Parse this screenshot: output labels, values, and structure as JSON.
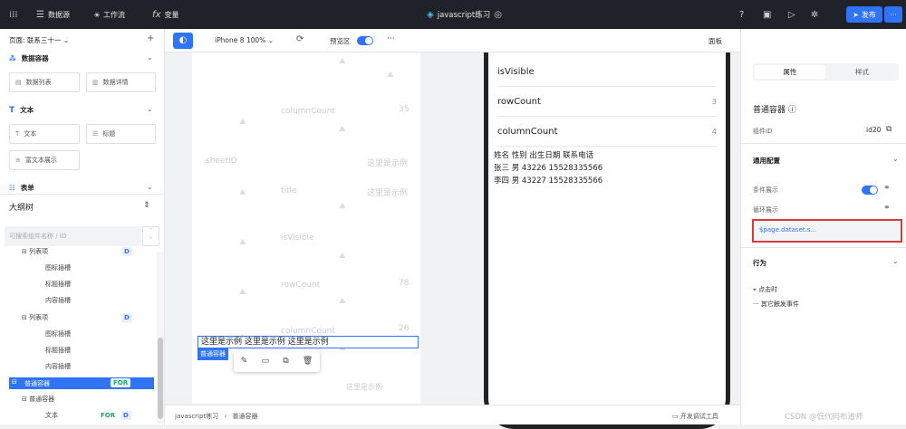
{
  "topbar": {
    "grid_icon": "grid-icon",
    "datasource": "数据源",
    "workflow": "工作流",
    "variables": "变量",
    "app_title": "javascript练习",
    "publish": "发布",
    "more": "···"
  },
  "left": {
    "page_selector": "页面: 联系三十一",
    "add": "+",
    "sections": {
      "data_container": "数据容器",
      "text": "文本",
      "form": "表单"
    },
    "components": {
      "data_list": "数据列表",
      "data_detail": "数据详情",
      "text": "文本",
      "title": "标题",
      "rich_text": "富文本展示"
    },
    "outline_title": "大纲树",
    "search_placeholder": "可搜索组件名称 / ID",
    "tree": {
      "r0": "列表项",
      "r0_badge": "D",
      "r1": "图标插槽",
      "r2": "标题插槽",
      "r3": "内容插槽",
      "r4": "列表项",
      "r4_badge": "D",
      "r5": "图标插槽",
      "r6": "标题插槽",
      "r7": "内容插槽",
      "r8": "普通容器",
      "r8_badge": "FOR",
      "r9": "普通容器",
      "r10": "文本",
      "r10_badge1": "FOR",
      "r10_badge2": "D"
    }
  },
  "canvas": {
    "device": "iPhone 8 100%",
    "preview": "预览区",
    "more": "···",
    "panel_btn": "面板",
    "ghost": {
      "columnCount": "columnCount",
      "columnCount_num": "35",
      "sheetID": "sheetID",
      "example1": "这里是示例",
      "title": "title",
      "example2": "这里是示例",
      "isVisible": "isVisible",
      "rowCount": "rowCount",
      "rowCount_num": "78",
      "columnCount2": "columnCount",
      "columnCount2_num": "26"
    },
    "phone": {
      "isVisible": "isVisible",
      "rowCount": "rowCount",
      "rowCount_val": "3",
      "columnCount": "columnCount",
      "columnCount_val": "4",
      "line1": "姓名 性别 出生日期 联系电话",
      "line2": "张三 男 43226 15528335566",
      "line3": "李四 男 43227 15528335566"
    },
    "selected_text": "这里是示例 这里是示例 这里是示例",
    "selected_label": "普通容器",
    "ghost_below": "这里是示例"
  },
  "status": {
    "breadcrumb_root": "javascript练习",
    "breadcrumb_sep": "›",
    "breadcrumb_leaf": "普通容器",
    "dev_tools": "开发调试工具"
  },
  "right": {
    "tab_props": "属性",
    "tab_style": "样式",
    "title": "普通容器",
    "component_id_label": "组件ID",
    "component_id_value": "id20",
    "general_config": "通用配置",
    "cond_show": "条件展示",
    "loop_show": "循环展示",
    "loop_value": "$page.dataset.s...",
    "behavior": "行为",
    "on_click": "点击时",
    "other_events": "其它触发事件"
  },
  "watermark": "CSDN @低代码布道师",
  "colors": {
    "accent": "#2f74f5",
    "highlight_border": "#d93a3a",
    "badge_for": "#27a36b"
  }
}
